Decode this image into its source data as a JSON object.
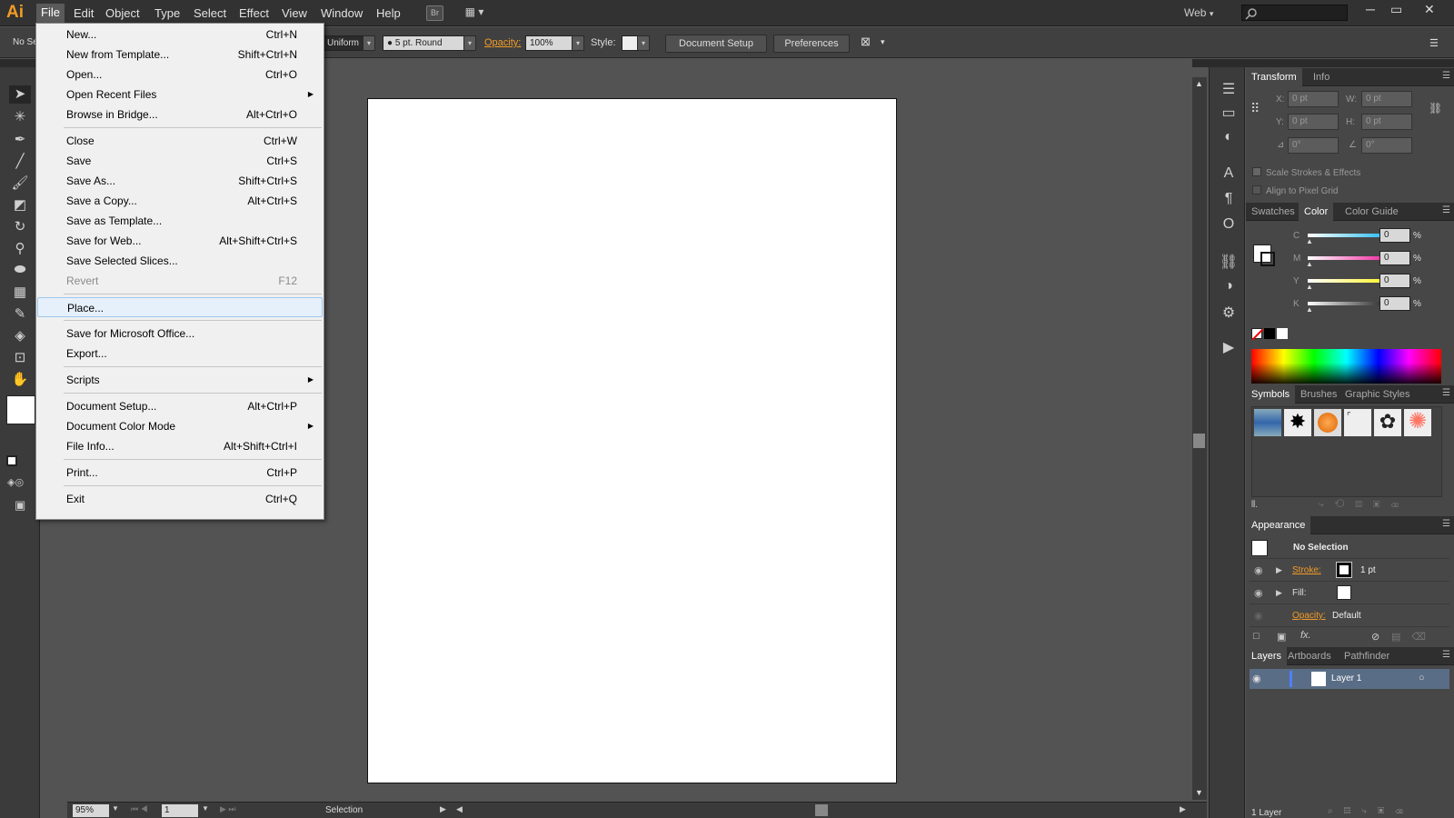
{
  "app": {
    "logo": "Ai",
    "workspace": "Web",
    "workspace_caret": "▾",
    "window_min": "─",
    "window_restore": "▭",
    "window_close": "✕"
  },
  "menubar": {
    "items": [
      "File",
      "Edit",
      "Object",
      "Type",
      "Select",
      "Effect",
      "View",
      "Window",
      "Help"
    ],
    "bridge": "Br",
    "arrange": "▦ ▾"
  },
  "control": {
    "left_label": "No Se",
    "stroke_profile": "Uniform",
    "brush": "●  5 pt. Round",
    "opacity_label": "Opacity:",
    "opacity_value": "100%",
    "style_label": "Style:",
    "document_setup": "Document Setup",
    "preferences": "Preferences",
    "dropdown_caret": "▾"
  },
  "file_menu": [
    {
      "label": "New...",
      "shortcut": "Ctrl+N"
    },
    {
      "label": "New from Template...",
      "shortcut": "Shift+Ctrl+N"
    },
    {
      "label": "Open...",
      "shortcut": "Ctrl+O"
    },
    {
      "label": "Open Recent Files",
      "shortcut": "",
      "submenu": true
    },
    {
      "label": "Browse in Bridge...",
      "shortcut": "Alt+Ctrl+O"
    },
    {
      "label": "Close",
      "shortcut": "Ctrl+W",
      "sep_before": true
    },
    {
      "label": "Save",
      "shortcut": "Ctrl+S"
    },
    {
      "label": "Save As...",
      "shortcut": "Shift+Ctrl+S"
    },
    {
      "label": "Save a Copy...",
      "shortcut": "Alt+Ctrl+S"
    },
    {
      "label": "Save as Template...",
      "shortcut": ""
    },
    {
      "label": "Save for Web...",
      "shortcut": "Alt+Shift+Ctrl+S"
    },
    {
      "label": "Save Selected Slices...",
      "shortcut": ""
    },
    {
      "label": "Revert",
      "shortcut": "F12",
      "disabled": true
    },
    {
      "label": "Place...",
      "shortcut": "",
      "sep_before": true,
      "highlight": true
    },
    {
      "label": "Save for Microsoft Office...",
      "shortcut": "",
      "sep_before": true
    },
    {
      "label": "Export...",
      "shortcut": ""
    },
    {
      "label": "Scripts",
      "shortcut": "",
      "submenu": true,
      "sep_before": true
    },
    {
      "label": "Document Setup...",
      "shortcut": "Alt+Ctrl+P",
      "sep_before": true
    },
    {
      "label": "Document Color Mode",
      "shortcut": "",
      "submenu": true
    },
    {
      "label": "File Info...",
      "shortcut": "Alt+Shift+Ctrl+I"
    },
    {
      "label": "Print...",
      "shortcut": "Ctrl+P",
      "sep_before": true
    },
    {
      "label": "Exit",
      "shortcut": "Ctrl+Q",
      "sep_before": true
    }
  ],
  "submenu_arrow": "▶",
  "transform": {
    "tabs": [
      "Transform",
      "Info"
    ],
    "x_label": "X:",
    "x": "0 pt",
    "y_label": "Y:",
    "y": "0 pt",
    "w_label": "W:",
    "w": "0 pt",
    "h_label": "H:",
    "h": "0 pt",
    "rot": "0°",
    "shear": "0°",
    "scale_strokes": "Scale Strokes & Effects",
    "align_pixel": "Align to Pixel Grid"
  },
  "color": {
    "tabs": [
      "Swatches",
      "Color",
      "Color Guide"
    ],
    "channels": [
      {
        "name": "C",
        "value": "0"
      },
      {
        "name": "M",
        "value": "0"
      },
      {
        "name": "Y",
        "value": "0"
      },
      {
        "name": "K",
        "value": "0"
      }
    ],
    "pct": "%",
    "slider_colors": [
      "#00aeef",
      "#ec008c",
      "#fff200",
      "#000000"
    ]
  },
  "symbols": {
    "tabs": [
      "Symbols",
      "Brushes",
      "Graphic Styles"
    ]
  },
  "appearance": {
    "title": "Appearance",
    "no_selection": "No Selection",
    "stroke_label": "Stroke:",
    "stroke_value": "1 pt",
    "fill_label": "Fill:",
    "opacity_label": "Opacity:",
    "opacity_value": "Default",
    "fx": "fx."
  },
  "layers": {
    "tabs": [
      "Layers",
      "Artboards",
      "Pathfinder"
    ],
    "layer_name": "Layer 1",
    "count": "1 Layer"
  },
  "status": {
    "zoom": "95%",
    "artboard": "1",
    "tool": "Selection"
  },
  "accent": "#f29b26"
}
